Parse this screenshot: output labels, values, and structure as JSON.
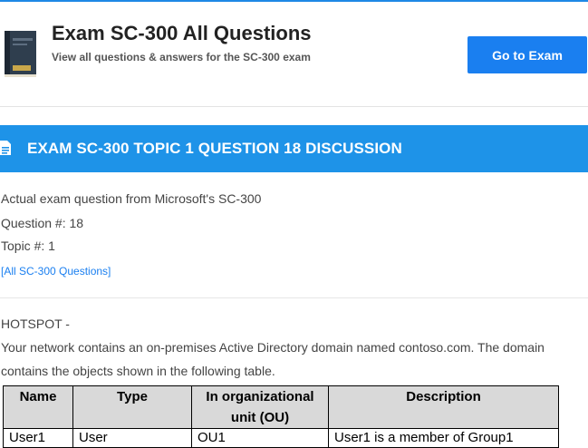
{
  "header": {
    "title": "Exam SC-300 All Questions",
    "subtitle": "View all questions & answers for the SC-300 exam",
    "button_label": "Go to Exam",
    "image_icon": "book-cover-icon"
  },
  "banner": {
    "icon": "document-icon",
    "title": "EXAM SC-300 TOPIC 1 QUESTION 18 DISCUSSION"
  },
  "meta": {
    "source": "Actual exam question from Microsoft's SC-300",
    "question": "Question #: 18",
    "topic": "Topic #: 1",
    "all_link": "[All SC-300 Questions]"
  },
  "question": {
    "type_label": "HOTSPOT -",
    "line1": "Your network contains an on-premises Active Directory domain named contoso.com. The domain",
    "line2": "contains the objects shown in the following table."
  },
  "table": {
    "headers": [
      "Name",
      "Type",
      "In organizational unit (OU)",
      "Description"
    ],
    "rows": [
      [
        "User1",
        "User",
        "OU1",
        "User1 is a member of Group1"
      ]
    ]
  },
  "colors": {
    "accent": "#1e93e8",
    "button": "#1a7ff0",
    "link": "#1a7ff0"
  }
}
